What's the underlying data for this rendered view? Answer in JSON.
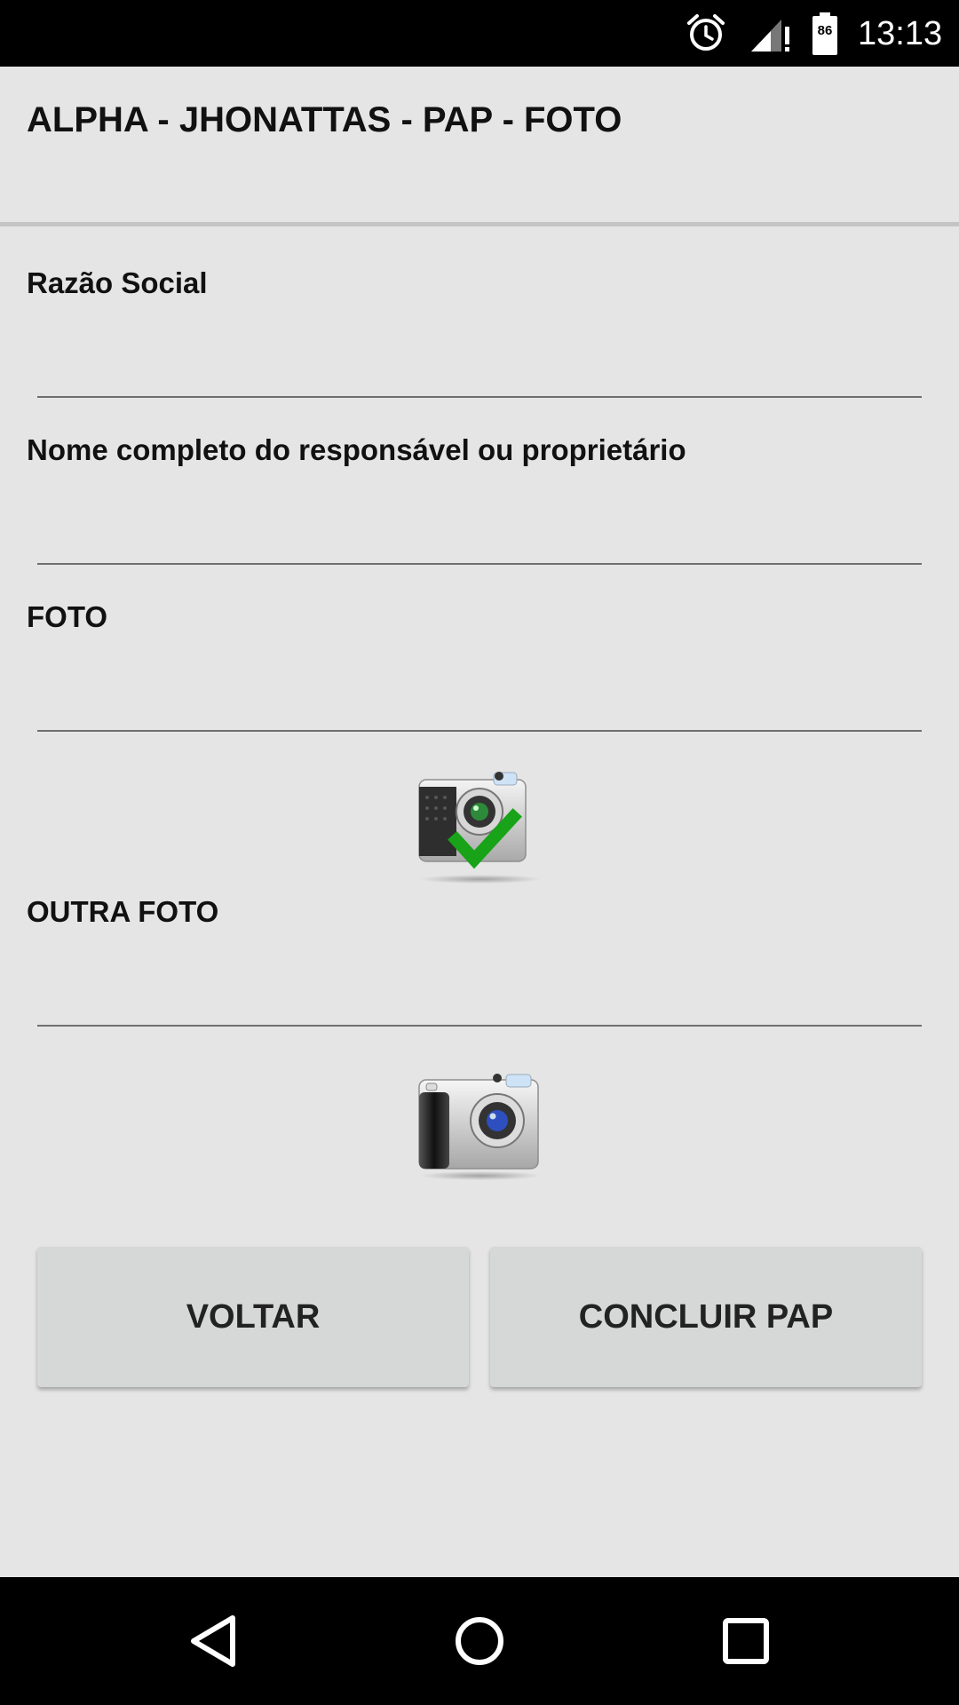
{
  "status_bar": {
    "time": "13:13",
    "battery_level": "86",
    "icons": [
      "alarm-icon",
      "signal-icon",
      "battery-icon"
    ]
  },
  "title": "ALPHA - JHONATTAS - PAP - FOTO",
  "form": {
    "razao_social_label": "Razão Social",
    "razao_social_value": "",
    "responsavel_label": "Nome completo do responsável ou proprietário",
    "responsavel_value": "",
    "foto_label": "FOTO",
    "foto_value": "",
    "foto_status": "camera-checked-icon",
    "outra_foto_label": "OUTRA FOTO",
    "outra_foto_value": "",
    "outra_foto_status": "camera-icon"
  },
  "buttons": {
    "back": "VOLTAR",
    "finish": "CONCLUIR PAP"
  },
  "nav_bar": {
    "icons": [
      "back-icon",
      "home-icon",
      "recents-icon"
    ]
  },
  "colors": {
    "background": "#e5e5e5",
    "button": "#d6d7d7",
    "check": "#1aa31a",
    "bars": "#000000"
  }
}
